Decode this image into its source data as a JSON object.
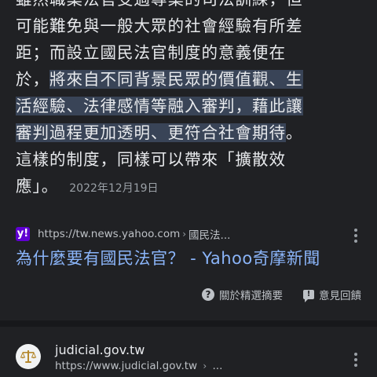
{
  "snippet": {
    "line_0": "雖然職業法官受過專業的司法訓練，但",
    "line_1": "可能難免與一般大眾的社會經驗有所差",
    "line_2": "距；而設立國民法官制度的意義便在",
    "line_3_plain": "於，",
    "line_3_highlight": "將來自不同背景民眾的價值觀、生",
    "line_4_highlight": "活經驗、法律感情等融入審判，藉此讓",
    "line_5_highlight": "審判過程更加透明、更符合社會期待",
    "line_5_plain": "。",
    "line_6": "這樣的制度，同樣可以帶來「擴散效",
    "line_7": "應」。",
    "date": "2022年12月19日",
    "highlight_color": "#394457"
  },
  "result": {
    "favicon_letter": "y!",
    "favicon_color": "#6001d2",
    "source_url": "https://tw.news.yahoo.com",
    "breadcrumb": "國民法...",
    "title": "為什麼要有國民法官？ - Yahoo奇摩新聞",
    "title_color": "#8ab4f8"
  },
  "feedback": {
    "about_label": "關於精選摘要",
    "feedback_label": "意見回饋",
    "about_icon": "help-circle-icon",
    "feedback_icon": "feedback-icon"
  },
  "next_result": {
    "site_name": "judicial.gov.tw",
    "url": "https://www.judicial.gov.tw",
    "logo_icon": "scales-of-justice-icon"
  }
}
